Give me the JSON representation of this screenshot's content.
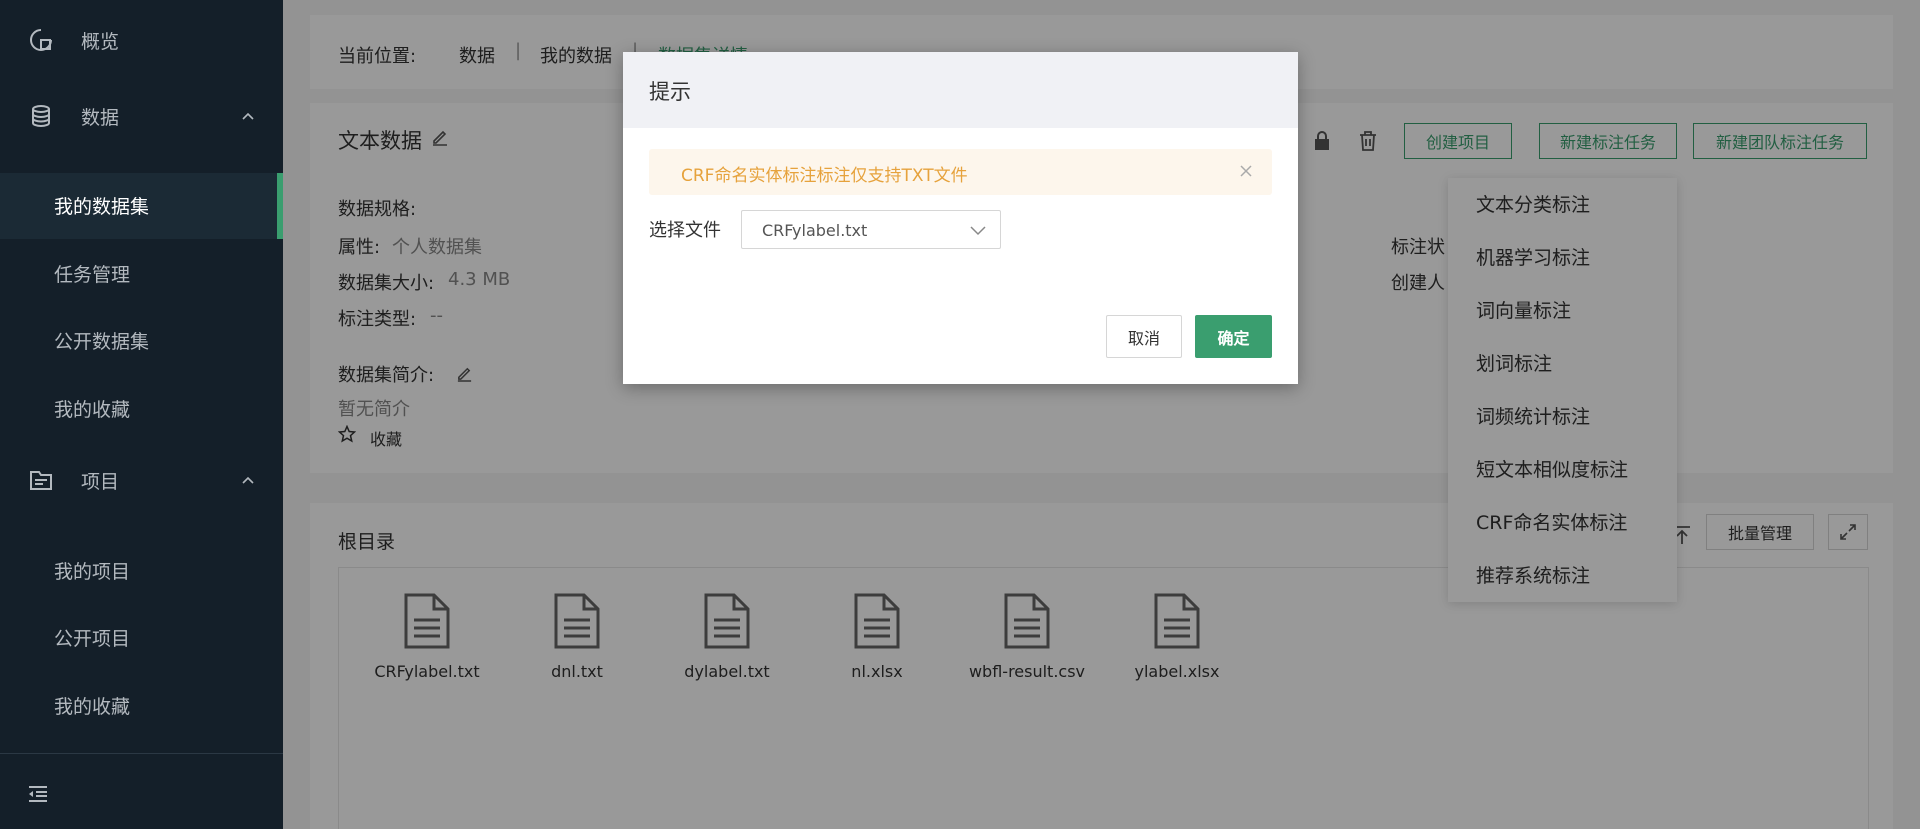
{
  "sidebar": {
    "overview": "概览",
    "data_group": "数据",
    "data_items": [
      "我的数据集",
      "任务管理",
      "公开数据集",
      "我的收藏"
    ],
    "project_group": "项目",
    "project_items": [
      "我的项目",
      "公开项目",
      "我的收藏"
    ]
  },
  "breadcrumb": {
    "prefix": "当前位置:",
    "items": [
      "数据",
      "我的数据",
      "数据集详情"
    ],
    "separator": "|"
  },
  "dataset": {
    "title": "文本数据",
    "spec_label": "数据规格:",
    "attr_label": "属性:",
    "attr_value": "个人数据集",
    "size_label": "数据集大小:",
    "size_value": "4.3 MB",
    "type_label": "标注类型:",
    "type_value": "--",
    "intro_label": "数据集简介:",
    "intro_value": "暂无简介",
    "favorite": "收藏",
    "status_label": "标注状",
    "creator_label": "创建人"
  },
  "actions": {
    "create_project": "创建项目",
    "new_task": "新建标注任务",
    "new_team_task": "新建团队标注任务"
  },
  "dropdown": {
    "options": [
      "文本分类标注",
      "机器学习标注",
      "词向量标注",
      "划词标注",
      "词频统计标注",
      "短文本相似度标注",
      "CRF命名实体标注",
      "推荐系统标注"
    ]
  },
  "files_panel": {
    "title": "根目录",
    "batch": "批量管理",
    "files": [
      "CRFylabel.txt",
      "dnl.txt",
      "dylabel.txt",
      "nl.xlsx",
      "wbfl-result.csv",
      "ylabel.xlsx"
    ]
  },
  "modal": {
    "title": "提示",
    "alert": "CRF命名实体标注标注仅支持TXT文件",
    "field_label": "选择文件",
    "select_value": "CRFylabel.txt",
    "cancel": "取消",
    "confirm": "确定"
  },
  "colors": {
    "accent": "#3a9e6f",
    "warning": "#e6a23c",
    "sidebar_bg": "#141f29"
  }
}
